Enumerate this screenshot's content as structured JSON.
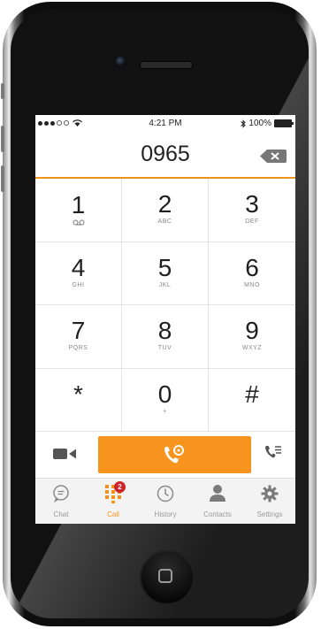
{
  "status_bar": {
    "time": "4:21 PM",
    "battery": "100%"
  },
  "dialer": {
    "number": "0965"
  },
  "keypad": [
    {
      "digit": "1",
      "letters": ""
    },
    {
      "digit": "2",
      "letters": "ABC"
    },
    {
      "digit": "3",
      "letters": "DEF"
    },
    {
      "digit": "4",
      "letters": "GHI"
    },
    {
      "digit": "5",
      "letters": "JKL"
    },
    {
      "digit": "6",
      "letters": "MNO"
    },
    {
      "digit": "7",
      "letters": "PQRS"
    },
    {
      "digit": "8",
      "letters": "TUV"
    },
    {
      "digit": "9",
      "letters": "WXYZ"
    },
    {
      "digit": "*",
      "letters": ""
    },
    {
      "digit": "0",
      "letters": "+"
    },
    {
      "digit": "#",
      "letters": ""
    }
  ],
  "tabs": [
    {
      "label": "Chat",
      "icon": "chat-icon"
    },
    {
      "label": "Call",
      "icon": "dialpad-icon",
      "badge": "2",
      "active": true
    },
    {
      "label": "History",
      "icon": "clock-icon"
    },
    {
      "label": "Contacts",
      "icon": "person-icon"
    },
    {
      "label": "Settings",
      "icon": "gear-icon"
    }
  ],
  "colors": {
    "accent": "#f7941e",
    "badge": "#d0222a"
  }
}
